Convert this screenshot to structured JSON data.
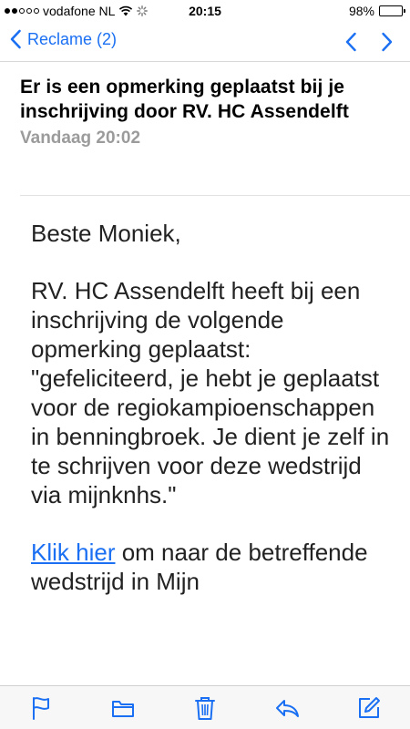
{
  "status_bar": {
    "carrier": "vodafone NL",
    "time": "20:15",
    "battery": "98%",
    "battery_level": 0.98
  },
  "nav": {
    "back_label": "Reclame (2)"
  },
  "mail": {
    "subject": "Er is een opmerking geplaatst bij je inschrijving door RV. HC Assendelft",
    "date": "Vandaag 20:02",
    "greeting": "Beste Moniek,",
    "paragraph": "RV. HC Assendelft heeft bij een inschrijving de volgende opmerking geplaatst: \"gefeliciteerd, je hebt je geplaatst voor de regiokampioenschappen in benningbroek. Je dient je zelf in te schrijven voor deze wedstrijd via mijnknhs.\"",
    "link_text": "Klik hier",
    "link_rest": " om naar de betreffende wedstrijd in Mijn"
  },
  "toolbar": {
    "icons": [
      "flag-icon",
      "folder-icon",
      "trash-icon",
      "reply-icon",
      "compose-icon"
    ]
  },
  "colors": {
    "accent": "#1a6ff2",
    "date_gray": "#9b9b9b"
  }
}
